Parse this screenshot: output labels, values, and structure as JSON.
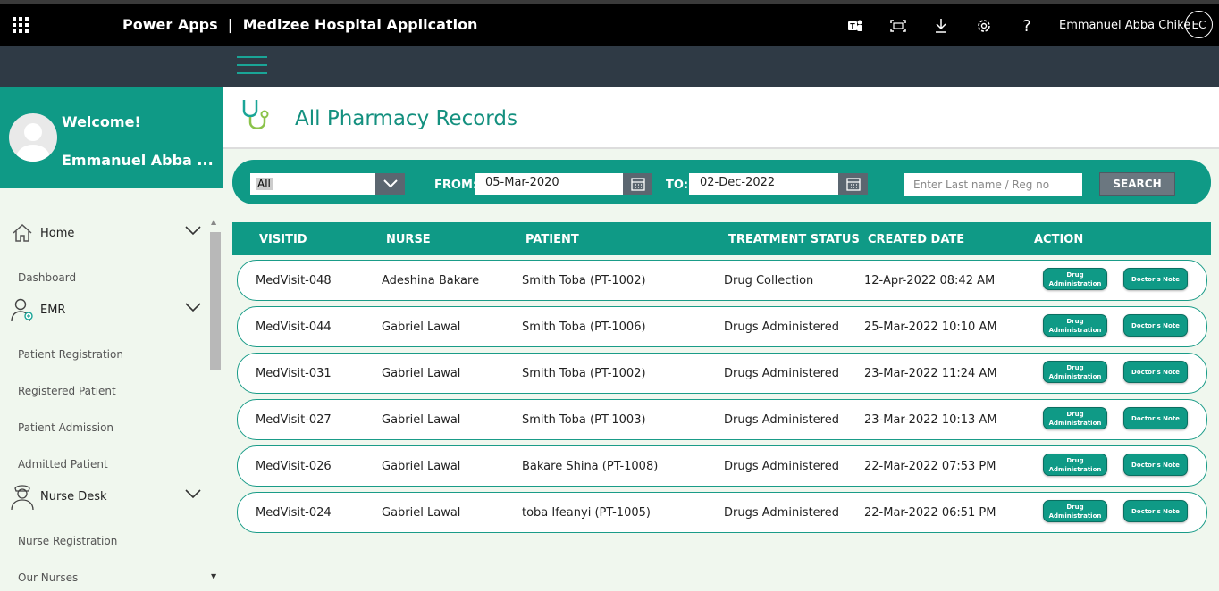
{
  "header": {
    "app_title": "Power Apps  |  Medizee Hospital Application",
    "user_name": "Emmanuel Abba Chike",
    "user_initials": "EC",
    "icons": [
      "teams-icon",
      "fit-screen-icon",
      "download-icon",
      "gear-icon",
      "help-icon"
    ]
  },
  "welcome": {
    "title": "Welcome!",
    "name": "Emmanuel Abba ..."
  },
  "sidebar": {
    "home": "Home",
    "dashboard": "Dashboard",
    "emr": "EMR",
    "patient_registration": "Patient Registration",
    "registered_patient": "Registered Patient",
    "patient_admission": "Patient Admission",
    "admitted_patient": "Admitted Patient",
    "nurse_desk": "Nurse Desk",
    "nurse_registration": "Nurse Registration",
    "our_nurses": "Our Nurses"
  },
  "page": {
    "title": "All Pharmacy Records"
  },
  "filter": {
    "status_value": "All",
    "from_label": "FROM:",
    "from_value": "05-Mar-2020",
    "to_label": "TO:",
    "to_value": "02-Dec-2022",
    "search_placeholder": "Enter Last name / Reg no",
    "search_label": "SEARCH"
  },
  "table": {
    "headers": {
      "visitid": "VISITID",
      "nurse": "NURSE",
      "patient": "PATIENT",
      "status": "TREATMENT STATUS",
      "created": "CREATED DATE",
      "action": "ACTION"
    },
    "drug_btn_line1": "Drug",
    "drug_btn_line2": "Administration",
    "note_btn": "Doctor's Note",
    "rows": [
      {
        "visitid": "MedVisit-048",
        "nurse": "Adeshina Bakare",
        "patient": "Smith Toba (PT-1002)",
        "status": "Drug Collection",
        "created": "12-Apr-2022 08:42 AM"
      },
      {
        "visitid": "MedVisit-044",
        "nurse": "Gabriel Lawal",
        "patient": "Smith Toba (PT-1006)",
        "status": "Drugs Administered",
        "created": "25-Mar-2022 10:10 AM"
      },
      {
        "visitid": "MedVisit-031",
        "nurse": "Gabriel Lawal",
        "patient": "Smith Toba (PT-1002)",
        "status": "Drugs Administered",
        "created": "23-Mar-2022 11:24 AM"
      },
      {
        "visitid": "MedVisit-027",
        "nurse": "Gabriel Lawal",
        "patient": "Smith Toba (PT-1003)",
        "status": "Drugs Administered",
        "created": "23-Mar-2022 10:13 AM"
      },
      {
        "visitid": "MedVisit-026",
        "nurse": "Gabriel Lawal",
        "patient": "Bakare Shina (PT-1008)",
        "status": "Drugs Administered",
        "created": "22-Mar-2022 07:53 PM"
      },
      {
        "visitid": "MedVisit-024",
        "nurse": "Gabriel Lawal",
        "patient": "toba Ifeanyi (PT-1005)",
        "status": "Drugs Administered",
        "created": "22-Mar-2022 06:51 PM"
      }
    ]
  },
  "colors": {
    "accent": "#0f9a86",
    "topbar": "#000000",
    "dark_band": "#2f3a45",
    "content_bg": "#f0f7ee"
  }
}
